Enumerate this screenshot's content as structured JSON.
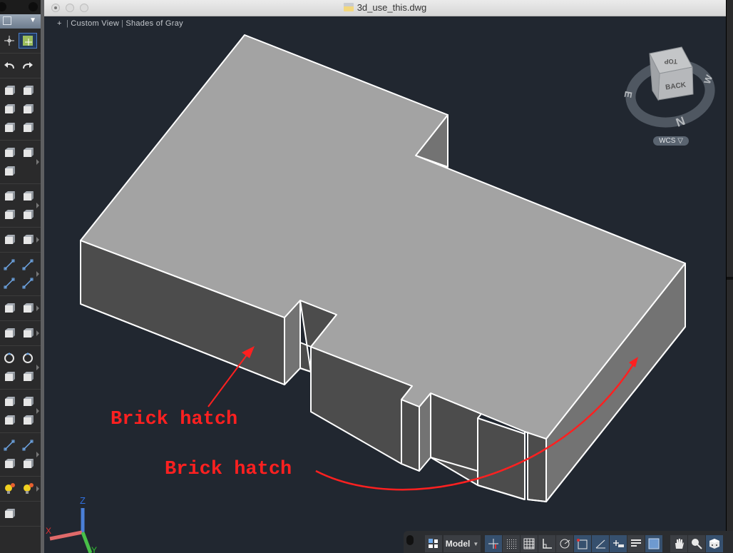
{
  "window": {
    "title": "3d_use_this.dwg"
  },
  "viewport": {
    "plus": "+",
    "view_label": "Custom View",
    "visual_style": "Shades of Gray"
  },
  "viewcube": {
    "faces": [
      "TOP",
      "BACK"
    ],
    "compass": [
      "N",
      "E",
      "W"
    ],
    "ucs_menu": "WCS ▽"
  },
  "annotations": [
    {
      "text": "Brick hatch"
    },
    {
      "text": "Brick hatch"
    }
  ],
  "ucs_icon": {
    "x": "X",
    "y": "Y",
    "z": "Z"
  },
  "tool_palette": {
    "groups": [
      [
        "point-icon",
        "selection-filter-icon"
      ],
      [
        "undo-icon",
        "redo-icon"
      ],
      [
        "box-icon",
        "cylinder-icon",
        "extrude-icon",
        "presspull-icon",
        "revolve-icon",
        "loft-icon"
      ],
      [
        "fillet-edge-icon",
        "chamfer-edge-icon",
        "union-icon"
      ],
      [
        "mesh-smooth-icon",
        "mesh-box-icon",
        "section-plane-icon",
        "solid-icon"
      ],
      [
        "sweep-icon",
        "3d-align-icon"
      ],
      [
        "line-icon",
        "arc-icon",
        "polyline-icon",
        "spline-icon"
      ],
      [
        "circle-icon",
        "rectangle-icon"
      ],
      [
        "extrude-face-icon",
        "erase-icon"
      ],
      [
        "move-icon",
        "rotate-icon",
        "scale-icon",
        "mirror-icon"
      ],
      [
        "array-icon",
        "3d-array-icon",
        "trim-icon",
        "offset-icon"
      ],
      [
        "break-icon",
        "join-icon",
        "fillet-icon",
        "chamfer-icon"
      ],
      [
        "point-light-icon",
        "spot-light-icon"
      ],
      [
        "render-icon"
      ]
    ]
  },
  "statusbar": {
    "model_label": "Model",
    "buttons": [
      {
        "name": "layout-grid-icon",
        "on": false
      },
      {
        "name": "snap-icon",
        "on": true
      },
      {
        "name": "grid-display-icon",
        "on": false
      },
      {
        "name": "grid-icon",
        "on": false
      },
      {
        "name": "ortho-icon",
        "on": false
      },
      {
        "name": "polar-tracking-icon",
        "on": false
      },
      {
        "name": "object-snap-icon",
        "on": true
      },
      {
        "name": "dynamic-ucs-icon",
        "on": true
      },
      {
        "name": "dynamic-input-icon",
        "on": true
      },
      {
        "name": "lineweight-icon",
        "on": false
      },
      {
        "name": "transparency-icon",
        "on": true
      },
      {
        "name": "pan-icon",
        "on": false
      },
      {
        "name": "zoom-icon",
        "on": false
      },
      {
        "name": "viewcube-toggle-icon",
        "on": true
      }
    ]
  },
  "colors": {
    "canvas_bg": "#212730",
    "top_face": "#a3a3a3",
    "front_face": "#4c4c4c",
    "side_face": "#737373",
    "edge": "#ffffff",
    "annotation": "#ff2020",
    "x_axis": "#e06060",
    "y_axis": "#40c040",
    "z_axis": "#3070e0"
  }
}
